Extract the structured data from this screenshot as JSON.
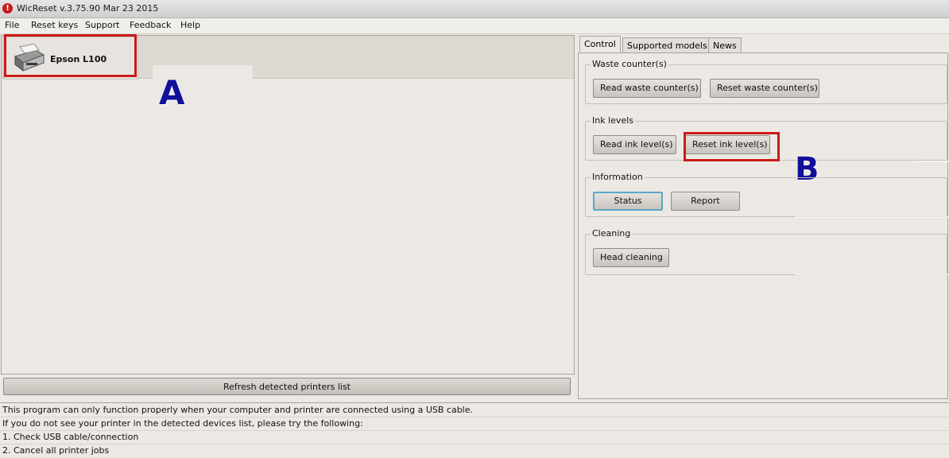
{
  "window": {
    "title": "WicReset v.3.75.90 Mar 23 2015",
    "icon": "wicreset-logo-icon"
  },
  "menu": {
    "items": [
      "File",
      "Reset keys",
      "Support",
      "Feedback",
      "Help"
    ]
  },
  "printers": {
    "selected_name": "Epson L100",
    "refresh_label": "Refresh detected printers list"
  },
  "annotations": {
    "label_a": "A",
    "label_b": "B",
    "highlight_color": "#cc1a1a",
    "label_color": "#10109a"
  },
  "tabs": [
    {
      "label": "Control",
      "active": true
    },
    {
      "label": "Supported models",
      "active": false
    },
    {
      "label": "News",
      "active": false
    }
  ],
  "groups": {
    "waste": {
      "legend": "Waste counter(s)",
      "read_label": "Read waste counter(s)",
      "reset_label": "Reset waste counter(s)"
    },
    "ink": {
      "legend": "Ink levels",
      "read_label": "Read ink level(s)",
      "reset_label": "Reset ink level(s)"
    },
    "information": {
      "legend": "Information",
      "status_label": "Status",
      "report_label": "Report"
    },
    "cleaning": {
      "legend": "Cleaning",
      "head_label": "Head cleaning"
    }
  },
  "info_lines": [
    "This program can only function properly when your computer and printer are connected using a USB cable.",
    "If you do not see your printer in the detected devices list, please try the following:",
    "1. Check USB cable/connection",
    "2. Cancel all printer jobs"
  ]
}
